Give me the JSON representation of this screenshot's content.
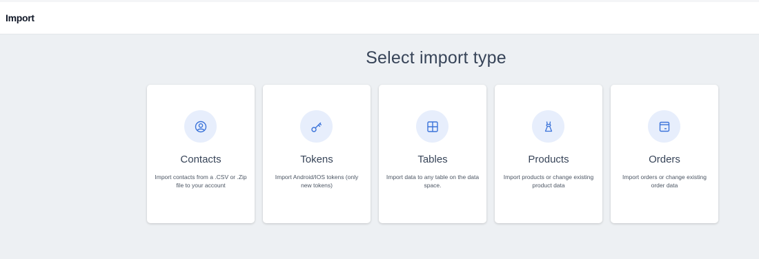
{
  "header": {
    "title": "Import"
  },
  "page": {
    "heading": "Select import type"
  },
  "colors": {
    "accent": "#3b73d9",
    "icon_bg": "#e7eefc",
    "page_bg": "#edf0f3"
  },
  "cards": [
    {
      "title": "Contacts",
      "description": "Import contacts from a .CSV or .Zip file to your account",
      "icon": "user-circle-icon"
    },
    {
      "title": "Tokens",
      "description": "Import Android/IOS tokens (only new tokens)",
      "icon": "key-icon"
    },
    {
      "title": "Tables",
      "description": "Import data to any table on the data space.",
      "icon": "table-grid-icon"
    },
    {
      "title": "Products",
      "description": "Import products or change existing product data",
      "icon": "dress-icon"
    },
    {
      "title": "Orders",
      "description": "Import orders or change existing order data",
      "icon": "box-icon"
    }
  ]
}
